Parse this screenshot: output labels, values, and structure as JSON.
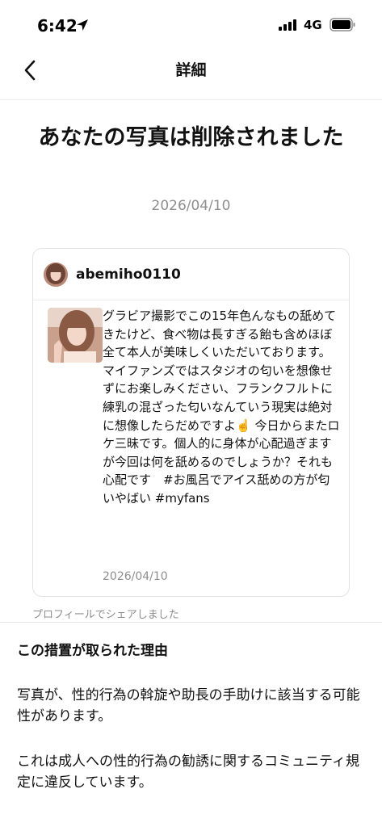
{
  "status_bar": {
    "time": "6:42",
    "network": "4G"
  },
  "nav": {
    "title": "詳細"
  },
  "notice": {
    "headline": "あなたの写真は削除されました",
    "date": "2026/04/10"
  },
  "post": {
    "username": "abemiho0110",
    "caption": "グラビア撮影でこの15年色んなもの舐めてきたけど、食べ物は長すぎる飴も含めほぼ全て本人が美味しくいただいております。マイファンズではスタジオの匂いを想像せずにお楽しみください、フランクフルトに練乳の混ざった匂いなんていう現実は絶対に想像したらだめですよ☝️ 今日からまたロケ三昧です。個人的に身体が心配過ぎますが今回は何を舐めるのでしょうか？それも心配です　#お風呂でアイス舐めの方が匂いやばい #myfans",
    "date": "2026/04/10"
  },
  "shared_note": "プロフィールでシェアしました",
  "reason": {
    "title": "この措置が取られた理由",
    "paragraph_1": "写真が、性的行為の斡旋や助長の手助けに該当する可能性があります。",
    "paragraph_2": "これは成人への性的行為の勧誘に関するコミュニティ規定に違反しています。"
  }
}
